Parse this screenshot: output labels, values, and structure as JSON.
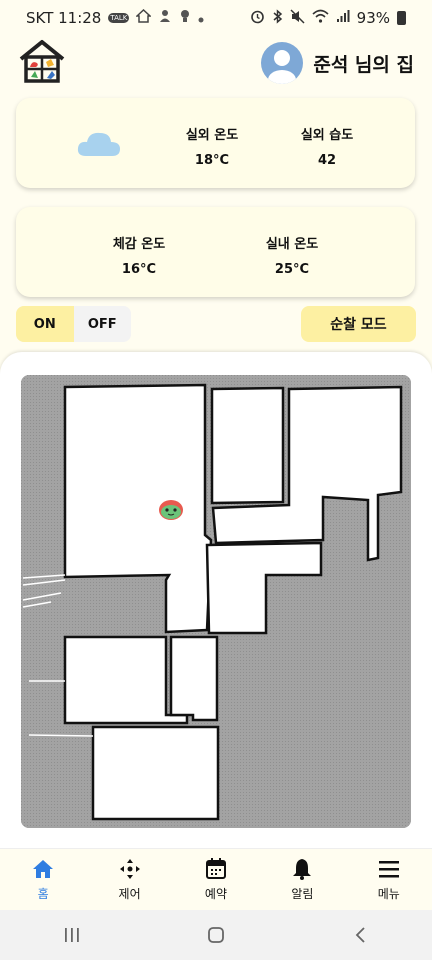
{
  "status_bar": {
    "carrier_time": "SKT 11:28",
    "talk_badge": "TALK",
    "battery": "93%"
  },
  "header": {
    "home_name": "준석 님의 집"
  },
  "weather": {
    "outdoor_temp_label": "실외 온도",
    "outdoor_temp_value": "18°C",
    "outdoor_humidity_label": "실외 습도",
    "outdoor_humidity_value": "42",
    "condition_icon": "cloud-icon"
  },
  "indoor": {
    "feels_like_label": "체감 온도",
    "feels_like_value": "16°C",
    "indoor_temp_label": "실내 온도",
    "indoor_temp_value": "25°C"
  },
  "controls": {
    "on_label": "ON",
    "off_label": "OFF",
    "patrol_label": "순찰 모드",
    "selected": "ON"
  },
  "nav": {
    "items": [
      {
        "label": "홈",
        "icon": "home-icon",
        "active": true
      },
      {
        "label": "제어",
        "icon": "dpad-icon",
        "active": false
      },
      {
        "label": "예약",
        "icon": "calendar-icon",
        "active": false
      },
      {
        "label": "알림",
        "icon": "bell-icon",
        "active": false
      },
      {
        "label": "메뉴",
        "icon": "menu-icon",
        "active": false
      }
    ]
  },
  "colors": {
    "background": "#fffdf0",
    "accent_yellow": "#fdf0a2",
    "active_blue": "#2f7de1",
    "map_gray": "#9d9d9d"
  }
}
